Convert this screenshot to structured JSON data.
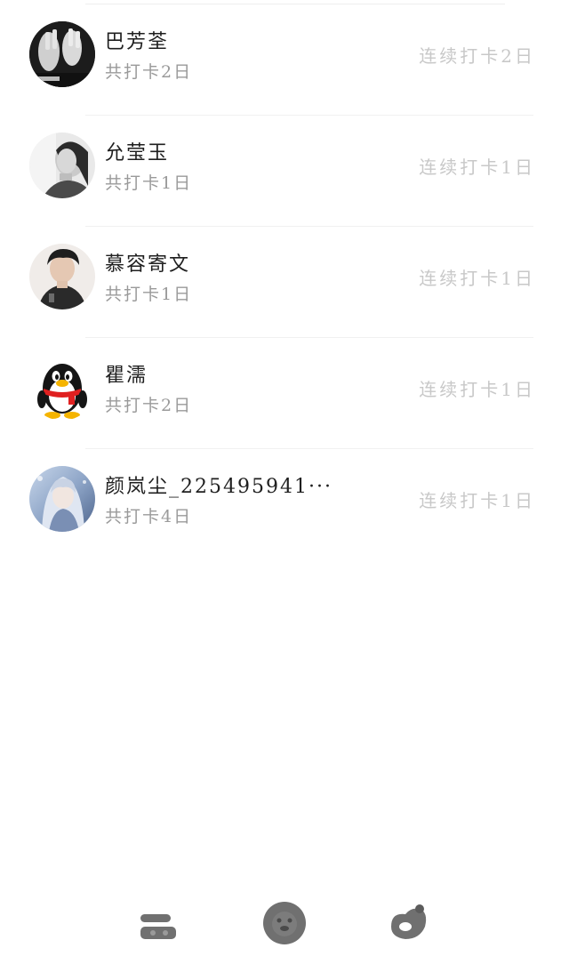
{
  "checkins": [
    {
      "name": "巴芳荃",
      "total": "共打卡2日",
      "streak": "连续打卡2日",
      "avatar_icon": "photo-avatar-hands-icon"
    },
    {
      "name": "允莹玉",
      "total": "共打卡1日",
      "streak": "连续打卡1日",
      "avatar_icon": "photo-avatar-portrait-icon"
    },
    {
      "name": "慕容寄文",
      "total": "共打卡1日",
      "streak": "连续打卡1日",
      "avatar_icon": "photo-avatar-person-icon"
    },
    {
      "name": "瞿濡",
      "total": "共打卡2日",
      "streak": "连续打卡1日",
      "avatar_icon": "qq-penguin-avatar-icon"
    },
    {
      "name": "颜岚尘_225495941···",
      "total": "共打卡4日",
      "streak": "连续打卡1日",
      "avatar_icon": "photo-avatar-anime-icon"
    }
  ],
  "tabbar": {
    "items": [
      {
        "icon": "list-toggle-icon"
      },
      {
        "icon": "lion-face-icon"
      },
      {
        "icon": "heart-ribbon-icon"
      }
    ],
    "icon_color": "#707070"
  },
  "colors": {
    "name_text": "#1f1f1f",
    "total_text": "#9a9a9a",
    "streak_text": "#c8c8c8",
    "divider": "#f1f1f1"
  }
}
